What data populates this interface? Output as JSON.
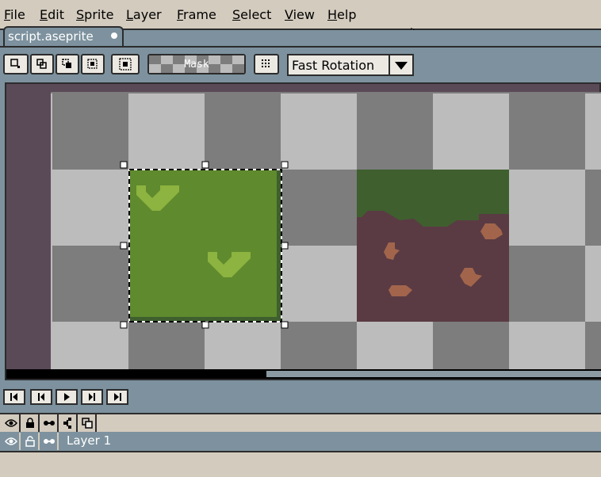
{
  "menu": {
    "items": [
      {
        "label": "File",
        "name": "menu-file"
      },
      {
        "label": "Edit",
        "name": "menu-edit"
      },
      {
        "label": "Sprite",
        "name": "menu-sprite"
      },
      {
        "label": "Layer",
        "name": "menu-layer"
      },
      {
        "label": "Frame",
        "name": "menu-frame"
      },
      {
        "label": "Select",
        "name": "menu-select"
      },
      {
        "label": "View",
        "name": "menu-view"
      },
      {
        "label": "Help",
        "name": "menu-help"
      }
    ]
  },
  "tab": {
    "label": "script.aseprite",
    "modified": true
  },
  "toolbar": {
    "mask_label": "Mask",
    "rotation_value": "Fast Rotation"
  },
  "timeline": {
    "layers": [
      {
        "label": "Layer 1"
      }
    ]
  },
  "colors": {
    "grass_dark": "#3f5f2e",
    "grass": "#5f8a2e",
    "grass_light": "#8db340",
    "dirt": "#5a3b43",
    "dirt_spot": "#a2654c",
    "checker_dark": "#7d7d7d",
    "checker_light": "#bcbcbc"
  }
}
